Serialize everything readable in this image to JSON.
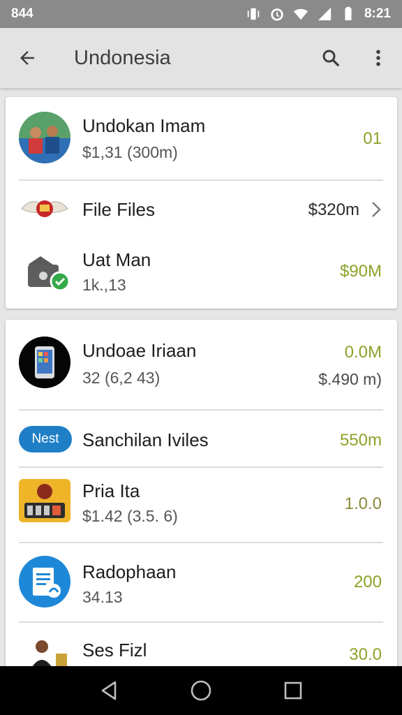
{
  "status_bar": {
    "time_left": "844",
    "time_right": "8:21"
  },
  "app_bar": {
    "title": "Undonesia",
    "icons": [
      "back-arrow-icon",
      "search-icon",
      "more-vert-icon"
    ]
  },
  "card1": {
    "rows": [
      {
        "title": "Undokan Imam",
        "subtitle": "$1,31 (300m)",
        "value": "01"
      },
      {
        "title": "File Files",
        "value": "$320m"
      },
      {
        "title": "Uat Man",
        "subtitle": "1k.,13",
        "value": "$90M"
      }
    ]
  },
  "card2": {
    "rows": [
      {
        "title": "Undoae Iriaan",
        "subtitle": "32 (6,2 43)",
        "value": "0.0M",
        "value2": "$.490 m)"
      },
      {
        "title": "Sanchilan Iviles",
        "badge": "Nest",
        "value": "550m"
      },
      {
        "title": "Pria Ita",
        "subtitle": "$1.42 (3.5. 6)",
        "value": "1.0.0"
      },
      {
        "title": "Radophaan",
        "subtitle": "34.13",
        "value": "200"
      },
      {
        "title": "Ses Fizl",
        "value": "30.0"
      }
    ]
  },
  "colors": {
    "accent_value": "#8aa328",
    "badge_blue": "#1f7fc6",
    "status_bar": "#8a8a8a"
  }
}
